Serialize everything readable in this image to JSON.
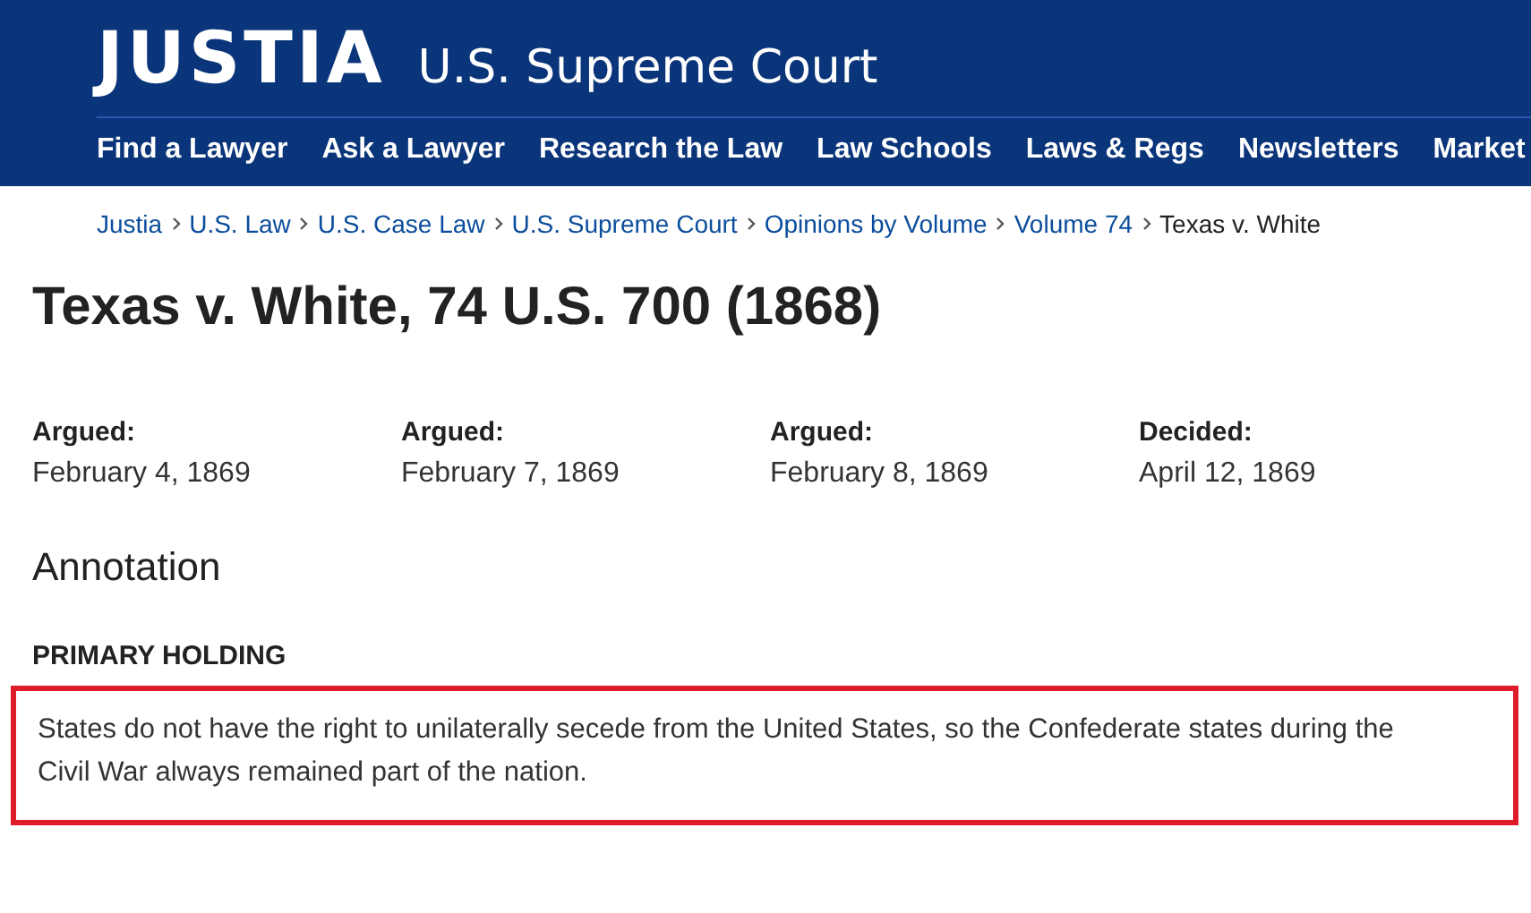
{
  "header": {
    "logo": "JUSTIA",
    "section": "U.S. Supreme Court"
  },
  "nav": [
    "Find a Lawyer",
    "Ask a Lawyer",
    "Research the Law",
    "Law Schools",
    "Laws & Regs",
    "Newsletters",
    "Market"
  ],
  "breadcrumb": [
    {
      "label": "Justia",
      "link": true
    },
    {
      "label": "U.S. Law",
      "link": true
    },
    {
      "label": "U.S. Case Law",
      "link": true
    },
    {
      "label": "U.S. Supreme Court",
      "link": true
    },
    {
      "label": "Opinions by Volume",
      "link": true
    },
    {
      "label": "Volume 74",
      "link": true
    },
    {
      "label": "Texas v. White",
      "link": false
    }
  ],
  "title": "Texas v. White, 74 U.S. 700 (1868)",
  "dates": [
    {
      "label": "Argued:",
      "date": "February 4, 1869"
    },
    {
      "label": "Argued:",
      "date": "February 7, 1869"
    },
    {
      "label": "Argued:",
      "date": "February 8, 1869"
    },
    {
      "label": "Decided:",
      "date": "April 12, 1869"
    }
  ],
  "annotation": {
    "heading": "Annotation",
    "subheading": "PRIMARY HOLDING",
    "text": "States do not have the right to unilaterally secede from the United States, so the Confederate states during the Civil War always remained part of the nation.",
    "highlighted": true
  }
}
